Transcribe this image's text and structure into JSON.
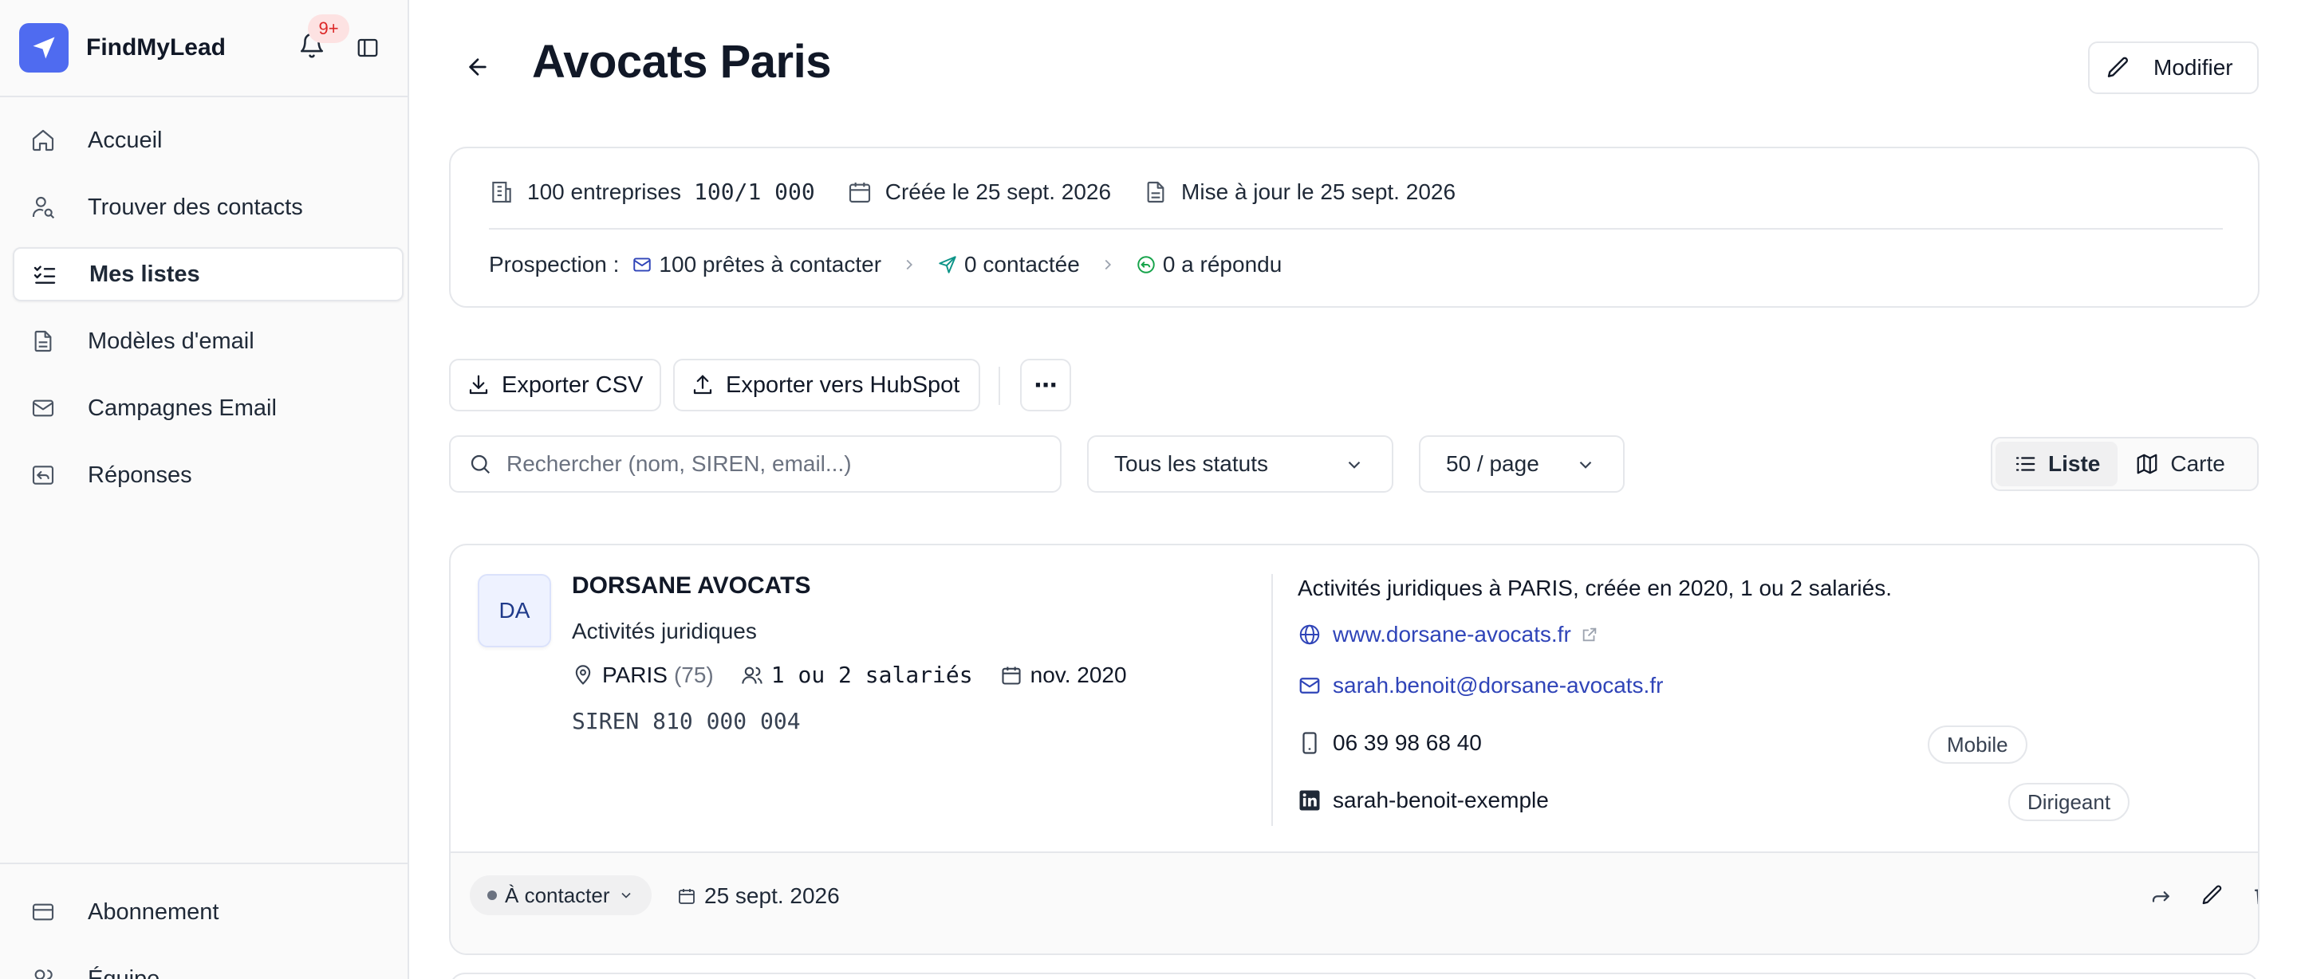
{
  "brand": {
    "name": "FindMyLead",
    "notification_count": "9+"
  },
  "sidebar": {
    "items": [
      {
        "label": "Accueil",
        "icon": "home-icon"
      },
      {
        "label": "Trouver des contacts",
        "icon": "user-search-icon"
      },
      {
        "label": "Mes listes",
        "icon": "list-checks-icon",
        "active": true
      },
      {
        "label": "Modèles d'email",
        "icon": "file-text-icon"
      },
      {
        "label": "Campagnes Email",
        "icon": "mail-icon"
      },
      {
        "label": "Réponses",
        "icon": "reply-icon"
      }
    ],
    "bottom_items": [
      {
        "label": "Abonnement",
        "icon": "credit-card-icon"
      },
      {
        "label": "Équipe",
        "icon": "users-icon"
      }
    ]
  },
  "page": {
    "title": "Avocats Paris",
    "modify_label": "Modifier"
  },
  "info": {
    "companies": "100 entreprises",
    "quota": "100/1 000",
    "created": "Créée le 25 sept. 2026",
    "updated": "Mise à jour le 25 sept. 2026",
    "prospection_label": "Prospection :",
    "ready": "100 prêtes à contacter",
    "contacted": "0 contactée",
    "replied": "0 a répondu"
  },
  "toolbar": {
    "export_csv": "Exporter CSV",
    "export_hubspot": "Exporter vers HubSpot",
    "more": "⋯"
  },
  "filters": {
    "search_placeholder": "Rechercher (nom, SIREN, email...)",
    "status_value": "Tous les statuts",
    "per_page_value": "50 / page",
    "view_list": "Liste",
    "view_map": "Carte"
  },
  "lead": {
    "initials": "DA",
    "name": "DORSANE AVOCATS",
    "activity": "Activités juridiques",
    "city": "PARIS",
    "department": "(75)",
    "employees": "1 ou 2 salariés",
    "founded": "nov. 2020",
    "siren": "SIREN 810 000 004",
    "description": "Activités juridiques à PARIS, créée en 2020, 1 ou 2 salariés.",
    "website": "www.dorsane-avocats.fr",
    "email": "sarah.benoit@dorsane-avocats.fr",
    "phone": "06 39 98 68 40",
    "phone_type": "Mobile",
    "linkedin": "sarah-benoit-exemple",
    "role": "Dirigeant",
    "status": "À contacter",
    "date": "25 sept. 2026"
  },
  "colors": {
    "accent": "#4f6bf0",
    "link": "#2f44b8",
    "whatsapp": "#16a34a",
    "send": "#0d9488"
  }
}
